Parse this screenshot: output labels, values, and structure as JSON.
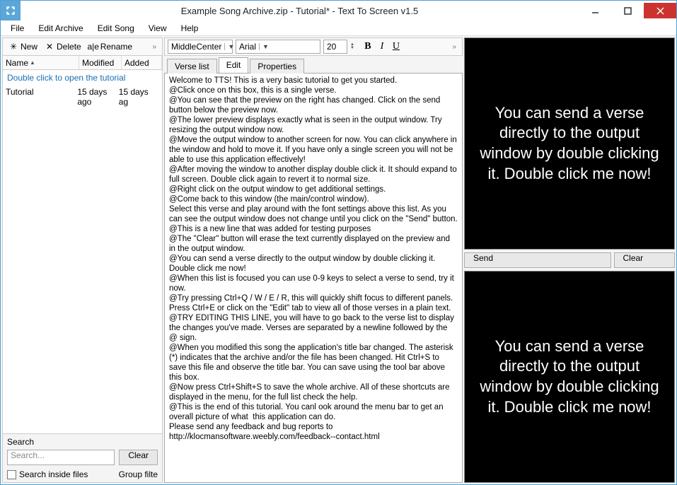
{
  "titlebar": {
    "title": "Example Song Archive.zip - Tutorial* - Text To Screen v1.5"
  },
  "menu": {
    "file": "File",
    "edit_archive": "Edit Archive",
    "edit_song": "Edit Song",
    "view": "View",
    "help": "Help"
  },
  "left_toolbar": {
    "new": "New",
    "delete": "Delete",
    "rename": "Rename"
  },
  "list_head": {
    "name": "Name",
    "modified": "Modified",
    "added": "Added"
  },
  "list_banner": "Double click to open the tutorial",
  "list_row": {
    "name": "Tutorial",
    "modified": "15 days ago",
    "added": "15 days ag"
  },
  "search": {
    "title": "Search",
    "placeholder": "Search...",
    "clear": "Clear",
    "inside": "Search inside files",
    "group": "Group filte"
  },
  "mid_toolbar": {
    "align": "MiddleCenter",
    "font": "Arial",
    "size": "20"
  },
  "tabs": {
    "verse": "Verse list",
    "edit": "Edit",
    "props": "Properties"
  },
  "editor_text": "Welcome to TTS! This is a very basic tutorial to get you started.\n@Click once on this box, this is a single verse.\n@You can see that the preview on the right has changed. Click on the send button below the preview now.\n@The lower preview displays exactly what is seen in the output window. Try resizing the output window now.\n@Move the output window to another screen for now. You can click anywhere in the window and hold to move it. If you have only a single screen you will not be able to use this application effectively!\n@After moving the window to another display double click it. It should expand to full screen. Double click again to revert it to normal size.\n@Right click on the output window to get additional settings.\n@Come back to this window (the main/control window).\nSelect this verse and play around with the font settings above this list. As you can see the output window does not change until you click on the \"Send\" button.\n@This is a new line that was added for testing purposes\n@The \"Clear\" button will erase the text currently displayed on the preview and in the output window.\n@You can send a verse directly to the output window by double clicking it. Double click me now!\n@When this list is focused you can use 0-9 keys to select a verse to send, try it now.\n@Try pressing Ctrl+Q / W / E / R, this will quickly shift focus to different panels. Press Ctrl+E or click on the \"Edit\" tab to view all of those verses in a plain text.\n@TRY EDITING THIS LINE, you will have to go back to the verse list to display the changes you've made. Verses are separated by a newline followed by the @ sign.\n@When you modified this song the application's title bar changed. The asterisk (*) indicates that the archive and/or the file has been changed. Hit Ctrl+S to save this file and observe the title bar. You can save using the tool bar above this box.\n@Now press Ctrl+Shift+S to save the whole archive. All of these shortcuts are displayed in the menu, for the full list check the help.\n@This is the end of this tutorial. You canl ook around the menu bar to get an overall picture of what  this application can do.\nPlease send any feedback and bug reports to http://klocmansoftware.weebly.com/feedback--contact.html",
  "preview_text": "You can send a verse directly to the output window by double clicking it. Double click me now!",
  "buttons": {
    "send": "Send",
    "clear": "Clear"
  }
}
